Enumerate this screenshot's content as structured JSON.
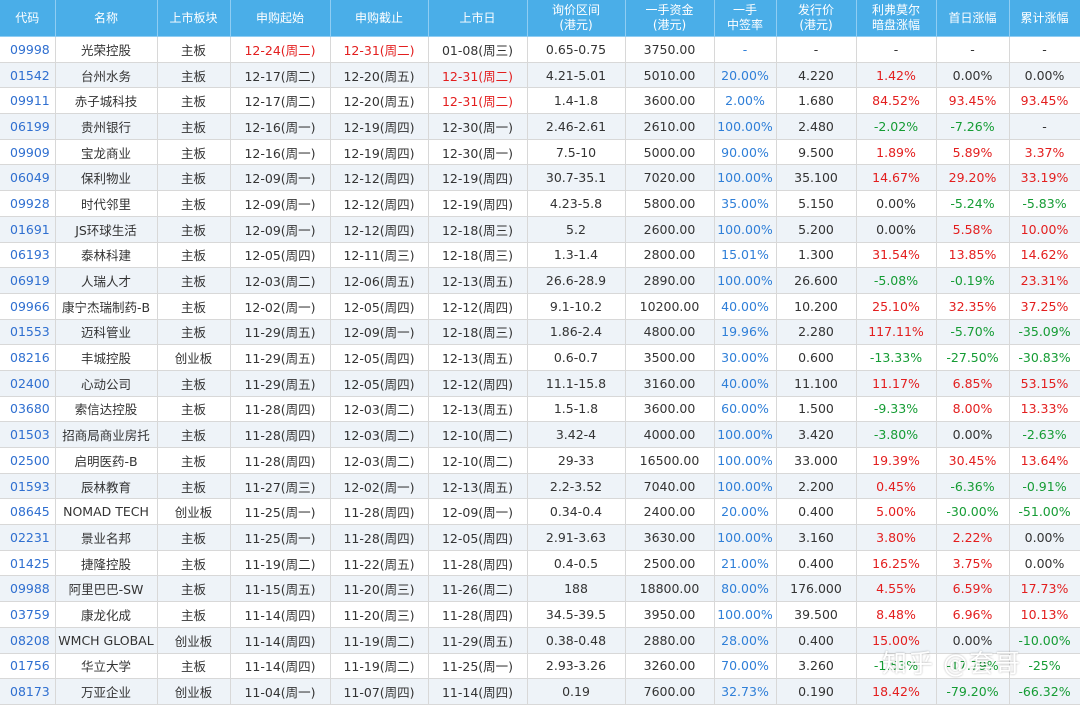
{
  "headers": [
    "代码",
    "名称",
    "上市板块",
    "申购起始",
    "申购截止",
    "上市日",
    "询价区间\n(港元)",
    "一手资金\n(港元)",
    "一手\n中签率",
    "发行价\n(港元)",
    "利弗莫尔\n暗盘涨幅",
    "首日涨幅",
    "累计涨幅"
  ],
  "rows": [
    {
      "code": "09998",
      "name": "光荣控股",
      "board": "主板",
      "start": "12-24(周二)",
      "end": "12-31(周二)",
      "list": "01-08(周三)",
      "range": "0.65-0.75",
      "lot": "3750.00",
      "rate": "-",
      "price": "-",
      "dark": "-",
      "first": "-",
      "total": "-"
    },
    {
      "code": "01542",
      "name": "台州水务",
      "board": "主板",
      "start": "12-17(周二)",
      "end": "12-20(周五)",
      "list": "12-31(周二)",
      "range": "4.21-5.01",
      "lot": "5010.00",
      "rate": "20.00%",
      "price": "4.220",
      "dark": "1.42%",
      "first": "0.00%",
      "total": "0.00%"
    },
    {
      "code": "09911",
      "name": "赤子城科技",
      "board": "主板",
      "start": "12-17(周二)",
      "end": "12-20(周五)",
      "list": "12-31(周二)",
      "range": "1.4-1.8",
      "lot": "3600.00",
      "rate": "2.00%",
      "price": "1.680",
      "dark": "84.52%",
      "first": "93.45%",
      "total": "93.45%"
    },
    {
      "code": "06199",
      "name": "贵州银行",
      "board": "主板",
      "start": "12-16(周一)",
      "end": "12-19(周四)",
      "list": "12-30(周一)",
      "range": "2.46-2.61",
      "lot": "2610.00",
      "rate": "100.00%",
      "price": "2.480",
      "dark": "-2.02%",
      "first": "-7.26%",
      "total": "-"
    },
    {
      "code": "09909",
      "name": "宝龙商业",
      "board": "主板",
      "start": "12-16(周一)",
      "end": "12-19(周四)",
      "list": "12-30(周一)",
      "range": "7.5-10",
      "lot": "5000.00",
      "rate": "90.00%",
      "price": "9.500",
      "dark": "1.89%",
      "first": "5.89%",
      "total": "3.37%"
    },
    {
      "code": "06049",
      "name": "保利物业",
      "board": "主板",
      "start": "12-09(周一)",
      "end": "12-12(周四)",
      "list": "12-19(周四)",
      "range": "30.7-35.1",
      "lot": "7020.00",
      "rate": "100.00%",
      "price": "35.100",
      "dark": "14.67%",
      "first": "29.20%",
      "total": "33.19%"
    },
    {
      "code": "09928",
      "name": "时代邻里",
      "board": "主板",
      "start": "12-09(周一)",
      "end": "12-12(周四)",
      "list": "12-19(周四)",
      "range": "4.23-5.8",
      "lot": "5800.00",
      "rate": "35.00%",
      "price": "5.150",
      "dark": "0.00%",
      "first": "-5.24%",
      "total": "-5.83%"
    },
    {
      "code": "01691",
      "name": "JS环球生活",
      "board": "主板",
      "start": "12-09(周一)",
      "end": "12-12(周四)",
      "list": "12-18(周三)",
      "range": "5.2",
      "lot": "2600.00",
      "rate": "100.00%",
      "price": "5.200",
      "dark": "0.00%",
      "first": "5.58%",
      "total": "10.00%"
    },
    {
      "code": "06193",
      "name": "泰林科建",
      "board": "主板",
      "start": "12-05(周四)",
      "end": "12-11(周三)",
      "list": "12-18(周三)",
      "range": "1.3-1.4",
      "lot": "2800.00",
      "rate": "15.01%",
      "price": "1.300",
      "dark": "31.54%",
      "first": "13.85%",
      "total": "14.62%"
    },
    {
      "code": "06919",
      "name": "人瑞人才",
      "board": "主板",
      "start": "12-03(周二)",
      "end": "12-06(周五)",
      "list": "12-13(周五)",
      "range": "26.6-28.9",
      "lot": "2890.00",
      "rate": "100.00%",
      "price": "26.600",
      "dark": "-5.08%",
      "first": "-0.19%",
      "total": "23.31%"
    },
    {
      "code": "09966",
      "name": "康宁杰瑞制药-B",
      "board": "主板",
      "start": "12-02(周一)",
      "end": "12-05(周四)",
      "list": "12-12(周四)",
      "range": "9.1-10.2",
      "lot": "10200.00",
      "rate": "40.00%",
      "price": "10.200",
      "dark": "25.10%",
      "first": "32.35%",
      "total": "37.25%"
    },
    {
      "code": "01553",
      "name": "迈科管业",
      "board": "主板",
      "start": "11-29(周五)",
      "end": "12-09(周一)",
      "list": "12-18(周三)",
      "range": "1.86-2.4",
      "lot": "4800.00",
      "rate": "19.96%",
      "price": "2.280",
      "dark": "117.11%",
      "first": "-5.70%",
      "total": "-35.09%"
    },
    {
      "code": "08216",
      "name": "丰城控股",
      "board": "创业板",
      "start": "11-29(周五)",
      "end": "12-05(周四)",
      "list": "12-13(周五)",
      "range": "0.6-0.7",
      "lot": "3500.00",
      "rate": "30.00%",
      "price": "0.600",
      "dark": "-13.33%",
      "first": "-27.50%",
      "total": "-30.83%"
    },
    {
      "code": "02400",
      "name": "心动公司",
      "board": "主板",
      "start": "11-29(周五)",
      "end": "12-05(周四)",
      "list": "12-12(周四)",
      "range": "11.1-15.8",
      "lot": "3160.00",
      "rate": "40.00%",
      "price": "11.100",
      "dark": "11.17%",
      "first": "6.85%",
      "total": "53.15%"
    },
    {
      "code": "03680",
      "name": "索信达控股",
      "board": "主板",
      "start": "11-28(周四)",
      "end": "12-03(周二)",
      "list": "12-13(周五)",
      "range": "1.5-1.8",
      "lot": "3600.00",
      "rate": "60.00%",
      "price": "1.500",
      "dark": "-9.33%",
      "first": "8.00%",
      "total": "13.33%"
    },
    {
      "code": "01503",
      "name": "招商局商业房托",
      "board": "主板",
      "start": "11-28(周四)",
      "end": "12-03(周二)",
      "list": "12-10(周二)",
      "range": "3.42-4",
      "lot": "4000.00",
      "rate": "100.00%",
      "price": "3.420",
      "dark": "-3.80%",
      "first": "0.00%",
      "total": "-2.63%"
    },
    {
      "code": "02500",
      "name": "启明医药-B",
      "board": "主板",
      "start": "11-28(周四)",
      "end": "12-03(周二)",
      "list": "12-10(周二)",
      "range": "29-33",
      "lot": "16500.00",
      "rate": "100.00%",
      "price": "33.000",
      "dark": "19.39%",
      "first": "30.45%",
      "total": "13.64%"
    },
    {
      "code": "01593",
      "name": "辰林教育",
      "board": "主板",
      "start": "11-27(周三)",
      "end": "12-02(周一)",
      "list": "12-13(周五)",
      "range": "2.2-3.52",
      "lot": "7040.00",
      "rate": "100.00%",
      "price": "2.200",
      "dark": "0.45%",
      "first": "-6.36%",
      "total": "-0.91%"
    },
    {
      "code": "08645",
      "name": "NOMAD TECH",
      "board": "创业板",
      "start": "11-25(周一)",
      "end": "11-28(周四)",
      "list": "12-09(周一)",
      "range": "0.34-0.4",
      "lot": "2400.00",
      "rate": "20.00%",
      "price": "0.400",
      "dark": "5.00%",
      "first": "-30.00%",
      "total": "-51.00%"
    },
    {
      "code": "02231",
      "name": "景业名邦",
      "board": "主板",
      "start": "11-25(周一)",
      "end": "11-28(周四)",
      "list": "12-05(周四)",
      "range": "2.91-3.63",
      "lot": "3630.00",
      "rate": "100.00%",
      "price": "3.160",
      "dark": "3.80%",
      "first": "2.22%",
      "total": "0.00%"
    },
    {
      "code": "01425",
      "name": "捷隆控股",
      "board": "主板",
      "start": "11-19(周二)",
      "end": "11-22(周五)",
      "list": "11-28(周四)",
      "range": "0.4-0.5",
      "lot": "2500.00",
      "rate": "21.00%",
      "price": "0.400",
      "dark": "16.25%",
      "first": "3.75%",
      "total": "0.00%"
    },
    {
      "code": "09988",
      "name": "阿里巴巴-SW",
      "board": "主板",
      "start": "11-15(周五)",
      "end": "11-20(周三)",
      "list": "11-26(周二)",
      "range": "188",
      "lot": "18800.00",
      "rate": "80.00%",
      "price": "176.000",
      "dark": "4.55%",
      "first": "6.59%",
      "total": "17.73%"
    },
    {
      "code": "03759",
      "name": "康龙化成",
      "board": "主板",
      "start": "11-14(周四)",
      "end": "11-20(周三)",
      "list": "11-28(周四)",
      "range": "34.5-39.5",
      "lot": "3950.00",
      "rate": "100.00%",
      "price": "39.500",
      "dark": "8.48%",
      "first": "6.96%",
      "total": "10.13%"
    },
    {
      "code": "08208",
      "name": "WMCH GLOBAL",
      "board": "创业板",
      "start": "11-14(周四)",
      "end": "11-19(周二)",
      "list": "11-29(周五)",
      "range": "0.38-0.48",
      "lot": "2880.00",
      "rate": "28.00%",
      "price": "0.400",
      "dark": "15.00%",
      "first": "0.00%",
      "total": "-10.00%"
    },
    {
      "code": "01756",
      "name": "华立大学",
      "board": "主板",
      "start": "11-14(周四)",
      "end": "11-19(周二)",
      "list": "11-25(周一)",
      "range": "2.93-3.26",
      "lot": "3260.00",
      "rate": "70.00%",
      "price": "3.260",
      "dark": "-1.53%",
      "first": "-17.79%",
      "total": "-25%"
    },
    {
      "code": "08173",
      "name": "万亚企业",
      "board": "创业板",
      "start": "11-04(周一)",
      "end": "11-07(周四)",
      "list": "11-14(周四)",
      "range": "0.19",
      "lot": "7600.00",
      "rate": "32.73%",
      "price": "0.190",
      "dark": "18.42%",
      "first": "-79.20%",
      "total": "-66.32%"
    }
  ],
  "red_dates": {
    "0": [
      "start",
      "end"
    ],
    "1": [
      "list"
    ],
    "2": [
      "list"
    ]
  },
  "watermark": "知乎 @套哥",
  "colors": {
    "header_bg": "#4aaee8",
    "code": "#2f6fd0",
    "positive": "#e31e1e",
    "negative": "#159c34",
    "rate": "#2f7fd8"
  }
}
